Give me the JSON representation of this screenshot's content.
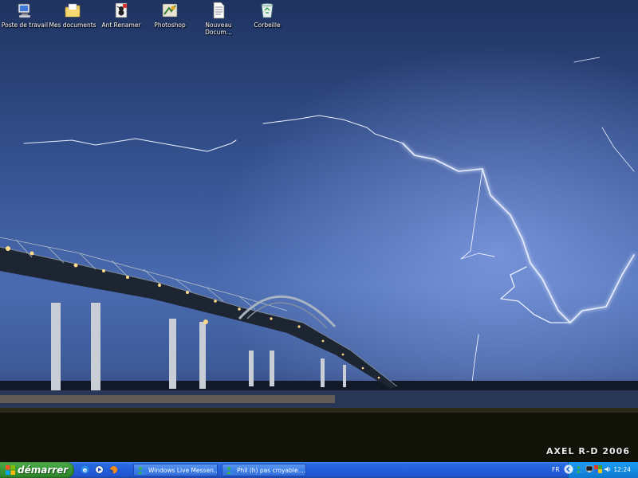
{
  "desktop": {
    "icons": [
      {
        "label": "Poste de travail",
        "icon": "my-computer-icon"
      },
      {
        "label": "Mes documents",
        "icon": "my-documents-icon"
      },
      {
        "label": "Ant Renamer",
        "icon": "ant-renamer-icon"
      },
      {
        "label": "Photoshop",
        "icon": "photoshop-icon"
      },
      {
        "label": "Nouveau Docum...",
        "icon": "text-document-icon"
      },
      {
        "label": "Corbeille",
        "icon": "recycle-bin-icon"
      }
    ],
    "wallpaper_credit": "AXEL R-D 2006"
  },
  "taskbar": {
    "start_label": "démarrer",
    "quick_launch": [
      "ie-icon",
      "media-player-icon",
      "firefox-icon"
    ],
    "quick_launch_more": "»",
    "tasks": [
      {
        "label": "Windows Live Messen...",
        "icon": "messenger-icon"
      },
      {
        "label": "Phil (h) pas croyable....",
        "icon": "messenger-chat-icon"
      }
    ],
    "tray": {
      "language": "FR",
      "icons": [
        "back-arrow-icon",
        "messenger-tray-icon",
        "network-icon",
        "color-tray-icon",
        "volume-icon"
      ],
      "clock": "12:24"
    }
  },
  "colors": {
    "taskbar_blue": "#245edb",
    "start_green": "#3a9b38",
    "tray_blue": "#138be3"
  }
}
